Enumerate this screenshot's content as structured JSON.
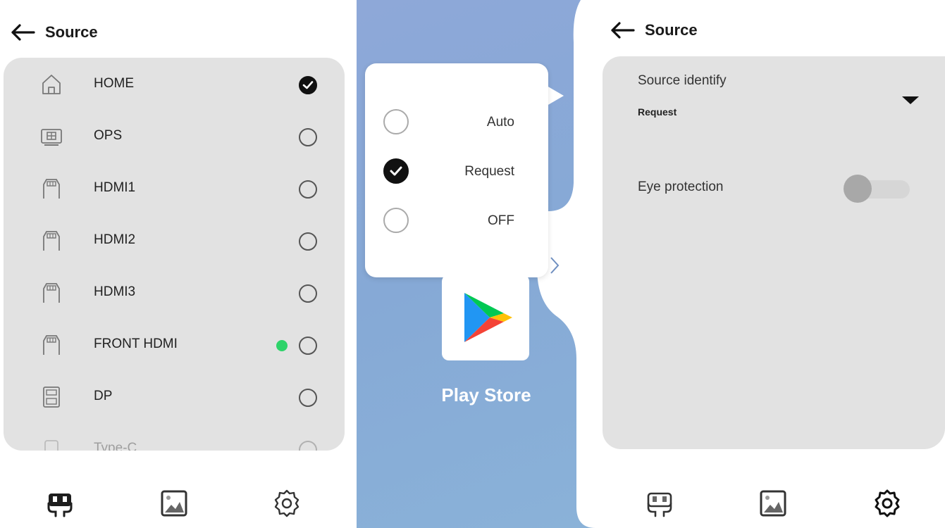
{
  "left_panel": {
    "header": {
      "title": "Source"
    },
    "sources": [
      {
        "label": "HOME",
        "icon": "home-icon",
        "selected": true,
        "live": false
      },
      {
        "label": "OPS",
        "icon": "ops-icon",
        "selected": false,
        "live": false
      },
      {
        "label": "HDMI1",
        "icon": "hdmi-icon",
        "selected": false,
        "live": false
      },
      {
        "label": "HDMI2",
        "icon": "hdmi-icon",
        "selected": false,
        "live": false
      },
      {
        "label": "HDMI3",
        "icon": "hdmi-icon",
        "selected": false,
        "live": false
      },
      {
        "label": "FRONT HDMI",
        "icon": "hdmi-icon",
        "selected": false,
        "live": true
      },
      {
        "label": "DP",
        "icon": "displayport-icon",
        "selected": false,
        "live": false
      },
      {
        "label": "Type-C",
        "icon": "type-c-icon",
        "selected": false,
        "live": false
      }
    ],
    "nav": [
      "source-icon",
      "picture-icon",
      "settings-icon"
    ]
  },
  "middle": {
    "popup": {
      "options": [
        {
          "label": "Auto",
          "selected": false
        },
        {
          "label": "Request",
          "selected": true
        },
        {
          "label": "OFF",
          "selected": false
        }
      ]
    },
    "app": {
      "name": "Play Store"
    }
  },
  "right_panel": {
    "header": {
      "title": "Source"
    },
    "source_identify": {
      "label": "Source identify",
      "value": "Request"
    },
    "eye_protection": {
      "label": "Eye protection",
      "enabled": false
    },
    "nav": [
      "source-icon",
      "picture-icon",
      "settings-icon"
    ]
  },
  "colors": {
    "card": "#e2e2e2",
    "live": "#2ed36a",
    "background_blue": "#8aabd7"
  }
}
